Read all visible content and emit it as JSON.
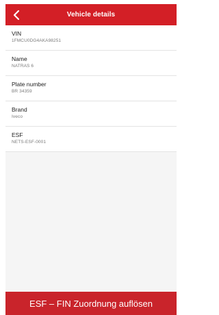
{
  "header": {
    "title": "Vehicle details",
    "back_icon": "chevron-left-icon"
  },
  "details": [
    {
      "label": "VIN",
      "value": "1FMCU0DG4AKA98251"
    },
    {
      "label": "Name",
      "value": "NATRAS 6"
    },
    {
      "label": "Plate number",
      "value": "BR 34359"
    },
    {
      "label": "Brand",
      "value": "Iveco"
    },
    {
      "label": "ESF",
      "value": "NETS-ESF-0001"
    }
  ],
  "action": {
    "label": "ESF – FIN Zuordnung auflösen"
  },
  "colors": {
    "accent": "#d31f26",
    "background": "#f5f5f5"
  }
}
